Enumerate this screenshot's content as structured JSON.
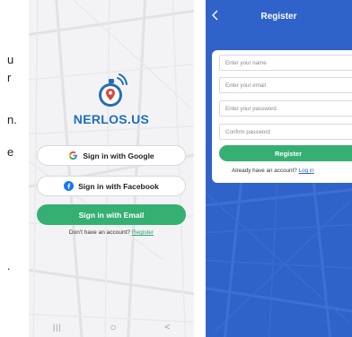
{
  "edge_text": [
    "u",
    "r",
    "n.",
    "e",
    "."
  ],
  "screen1": {
    "brand_name": "NERLOS.US",
    "google_label": "Sign in with Google",
    "facebook_label": "Sign in with Facebook",
    "email_label": "Sign in with Email",
    "no_account_text": "Don't have an account?",
    "register_link": "Register",
    "nav": {
      "recents": "|||",
      "home": "○",
      "back": "<"
    }
  },
  "screen2": {
    "back_glyph": "<",
    "title": "Register",
    "fields": {
      "name_placeholder": "Enter your name",
      "email_placeholder": "Enter your email",
      "password_placeholder": "Enter your password",
      "confirm_placeholder": "Confirm password"
    },
    "register_button": "Register",
    "have_account_text": "Already have an account?",
    "login_link": "Log in"
  },
  "colors": {
    "brand_blue": "#1f6fb8",
    "primary_green": "#35b072",
    "register_bg": "#2f63c9",
    "logo_accent": "#e0433b"
  }
}
